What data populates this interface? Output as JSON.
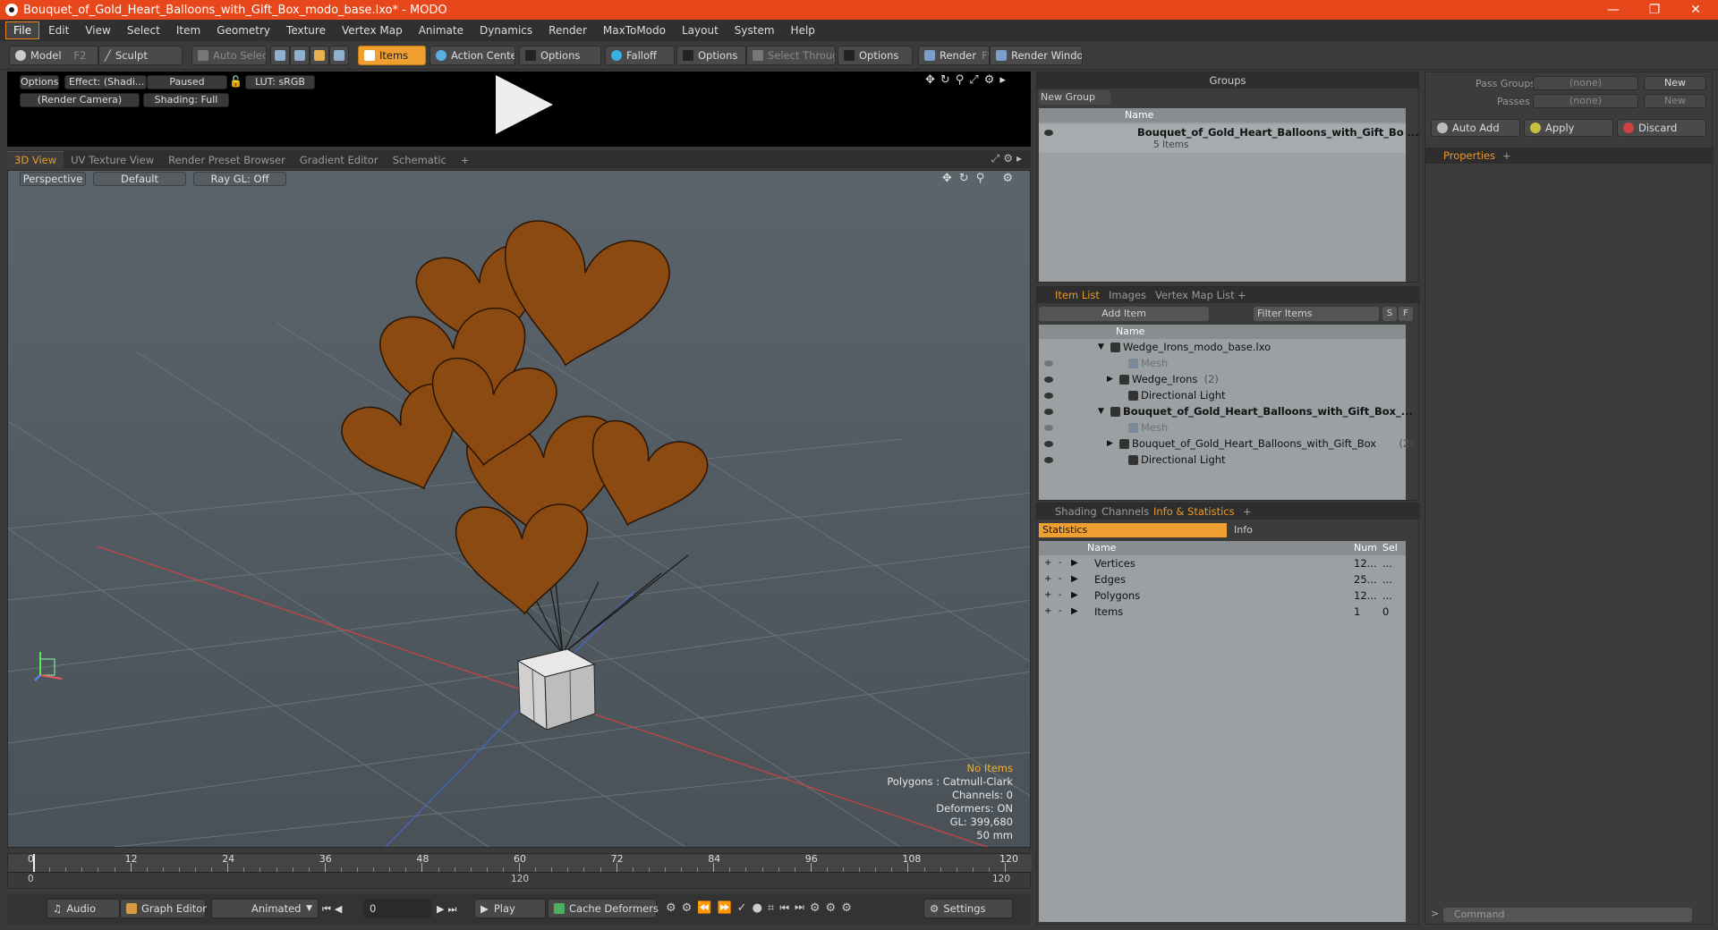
{
  "window": {
    "title": "Bouquet_of_Gold_Heart_Balloons_with_Gift_Box_modo_base.lxo* - MODO",
    "minimize": "—",
    "restore": "❐",
    "close": "✕"
  },
  "menu": [
    "File",
    "Edit",
    "View",
    "Select",
    "Item",
    "Geometry",
    "Texture",
    "Vertex Map",
    "Animate",
    "Dynamics",
    "Render",
    "MaxToModo",
    "Layout",
    "System",
    "Help"
  ],
  "toolbar": {
    "model": "Model",
    "model_key": "F2",
    "sculpt": "Sculpt",
    "auto_select": "Auto Select",
    "items": "Items",
    "action_center": "Action Center",
    "options1": "Options",
    "falloff": "Falloff",
    "options2": "Options",
    "select_through": "Select Through",
    "options3": "Options",
    "render": "Render",
    "render_key": "F9",
    "render_window": "Render Window"
  },
  "preview": {
    "options": "Options",
    "effect": "Effect: (Shadi...",
    "paused": "Paused",
    "lut": "LUT: sRGB",
    "camera": "(Render Camera)",
    "shading": "Shading: Full"
  },
  "view_tabs": [
    "3D View",
    "UV Texture View",
    "Render Preset Browser",
    "Gradient Editor",
    "Schematic",
    "+"
  ],
  "viewport": {
    "perspective": "Perspective",
    "default": "Default",
    "raygl": "Ray GL: Off",
    "hud": {
      "no_items": "No Items",
      "polygons": "Polygons : Catmull-Clark",
      "channels": "Channels: 0",
      "deformers": "Deformers: ON",
      "gl": "GL: 399,680",
      "lens": "50 mm"
    },
    "colors": {
      "balloon": "#8a4a12",
      "balloon_line": "#2a1404",
      "box": "#d8d8d8"
    }
  },
  "timeline": {
    "ticks": [
      "0",
      "12",
      "24",
      "36",
      "48",
      "60",
      "72",
      "84",
      "96",
      "108",
      "120"
    ],
    "start": "0",
    "mid": "120",
    "end": "120"
  },
  "bottom": {
    "audio": "Audio",
    "graph_editor": "Graph Editor",
    "animated": "Animated",
    "frame": "0",
    "play": "Play",
    "cache_deformers": "Cache Deformers",
    "settings": "Settings"
  },
  "groups": {
    "title": "Groups",
    "new_group": "New Group",
    "col_name": "Name",
    "item_name": "Bouquet_of_Gold_Heart_Balloons_with_Gift_Bo ...",
    "item_count": "5 Items"
  },
  "item_list": {
    "tabs": [
      "Item List",
      "Images",
      "Vertex Map List",
      "+"
    ],
    "add_item": "Add Item",
    "filter": "Filter Items",
    "s": "S",
    "f": "F",
    "col_name": "Name",
    "rows": [
      {
        "label": "Wedge_Irons_modo_base.lxo",
        "count": "",
        "indent": 0,
        "bold": false,
        "dim": false
      },
      {
        "label": "Mesh",
        "count": "",
        "indent": 2,
        "bold": false,
        "dim": true
      },
      {
        "label": "Wedge_Irons",
        "count": "(2)",
        "indent": 1,
        "bold": false,
        "dim": false
      },
      {
        "label": "Directional Light",
        "count": "",
        "indent": 2,
        "bold": false,
        "dim": false
      },
      {
        "label": "Bouquet_of_Gold_Heart_Balloons_with_Gift_Box_...",
        "count": "",
        "indent": 0,
        "bold": true,
        "dim": false
      },
      {
        "label": "Mesh",
        "count": "",
        "indent": 2,
        "bold": false,
        "dim": true
      },
      {
        "label": "Bouquet_of_Gold_Heart_Balloons_with_Gift_Box",
        "count": "(2)",
        "indent": 1,
        "bold": false,
        "dim": false
      },
      {
        "label": "Directional Light",
        "count": "",
        "indent": 2,
        "bold": false,
        "dim": false
      }
    ]
  },
  "info": {
    "tabs": [
      "Shading",
      "Channels",
      "Info & Statistics",
      "+"
    ],
    "statistics": "Statistics",
    "info": "Info",
    "cols": {
      "name": "Name",
      "num": "Num",
      "sel": "Sel"
    },
    "rows": [
      {
        "name": "Vertices",
        "num": "12...",
        "sel": "..."
      },
      {
        "name": "Edges",
        "num": "25...",
        "sel": "..."
      },
      {
        "name": "Polygons",
        "num": "12...",
        "sel": "..."
      },
      {
        "name": "Items",
        "num": "1",
        "sel": "0"
      }
    ]
  },
  "right": {
    "pass_groups": "Pass Groups",
    "passes": "Passes",
    "none1": "(none)",
    "none2": "(none)",
    "new1": "New",
    "new2": "New",
    "auto_add": "Auto Add",
    "apply": "Apply",
    "discard": "Discard",
    "properties": "Properties",
    "command": "Command"
  }
}
